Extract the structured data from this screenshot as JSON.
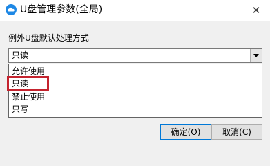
{
  "window": {
    "title": "U盘管理参数(全局)",
    "close_glyph": "✕"
  },
  "section_label": "例外U盘默认处理方式",
  "combo": {
    "selected": "只读"
  },
  "dropdown": {
    "options": [
      "允许使用",
      "只读",
      "禁止使用",
      "只写"
    ],
    "highlighted": "只读"
  },
  "buttons": {
    "ok_text": "确定",
    "ok_key": "O",
    "cancel_text": "取消",
    "cancel_key": "C"
  },
  "colors": {
    "highlight_border": "#c4232e",
    "app_icon": "#1e88e5"
  },
  "icons": {
    "app": "cloud-app-icon",
    "close": "close-icon",
    "dropdown": "chevron-down-icon"
  }
}
